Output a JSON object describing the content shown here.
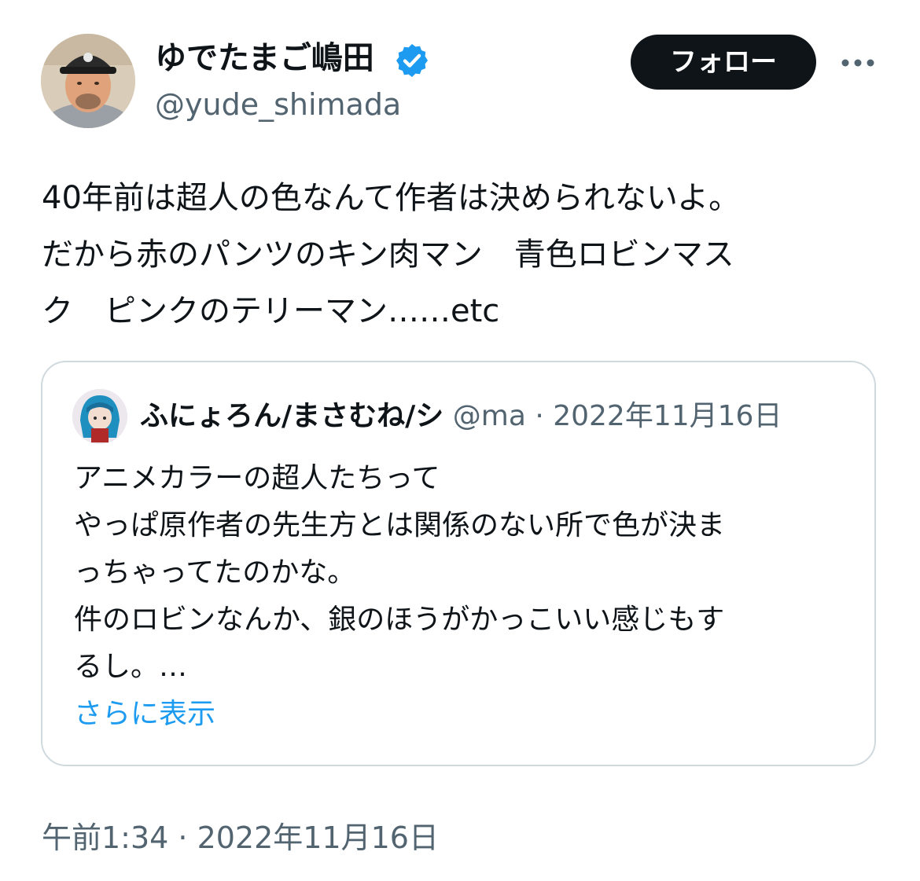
{
  "tweet": {
    "author": {
      "display_name": "ゆでたまご嶋田",
      "handle": "@yude_shimada",
      "verified_icon": "verified-badge-icon"
    },
    "follow_label": "フォロー",
    "more_icon": "more-dots-icon",
    "text_lines": [
      "40年前は超人の色なんて作者は決められないよ。",
      "だから赤のパンツのキン肉マン　青色ロビンマス",
      "ク　ピンクのテリーマン……etc"
    ],
    "timestamp": "午前1:34 · 2022年11月16日"
  },
  "quote": {
    "author_name": "ふにょろん/まさむね/シ",
    "meta": " @ma · 2022年11月16日",
    "text_lines": [
      "アニメカラーの超人たちって",
      "やっぱ原作者の先生方とは関係のない所で色が決ま",
      "っちゃってたのかな。",
      "件のロビンなんか、銀のほうがかっこいい感じもす",
      "るし。…"
    ],
    "show_more": "さらに表示"
  },
  "colors": {
    "text": "#0f1419",
    "secondary": "#536471",
    "link": "#1d9bf0",
    "border": "#cfd9de",
    "button_bg": "#0f1419"
  }
}
